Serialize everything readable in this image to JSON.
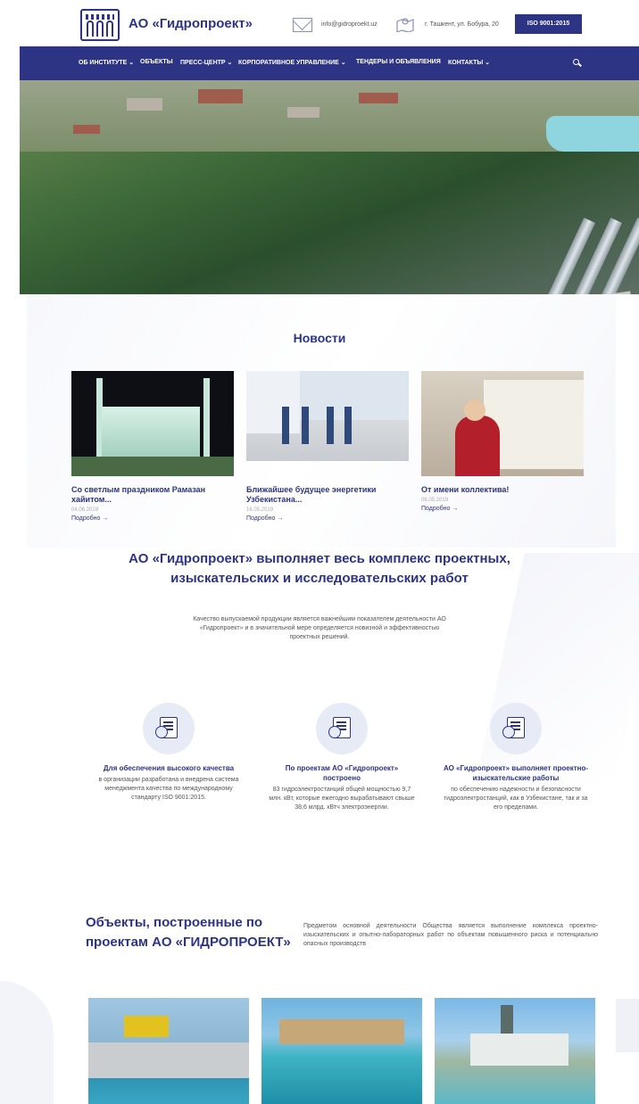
{
  "header": {
    "brand": "АО «Гидропроект»",
    "email": "info@gidroproekt.uz",
    "address": "г. Ташкент, ул. Бобура, 20",
    "iso_badge": "ISO 9001:2015"
  },
  "nav": {
    "items": [
      "ОБ ИНСТИТУТЕ ⌄",
      "ОБЪЕКТЫ",
      "ПРЕСС-ЦЕНТР ⌄",
      "КОРПОРАТИВНОЕ УПРАВЛЕНИЕ ⌄",
      "ТЕНДЕРЫ И ОБЪЯВЛЕНИЯ",
      "КОНТАКТЫ ⌄"
    ]
  },
  "news": {
    "title": "Новости",
    "items": [
      {
        "title": "Со светлым праздником Рамазан хайитом...",
        "date": "04.06.2019",
        "more": "Подробно →"
      },
      {
        "title": "Ближайшее будущее энергетики Узбекистана...",
        "date": "16.05.2019",
        "more": "Подробно →"
      },
      {
        "title": "От имени коллектива!",
        "date": "06.05.2019",
        "more": "Подробно →"
      }
    ]
  },
  "about": {
    "title": "АО «Гидропроект» выполняет весь комплекс проектных, изыскательских и исследовательских работ",
    "text": "Качество выпускаемой продукции является важнейшим показателем деятельности АО «Гидропроект» и в значительной мере определяется новизной и эффективностью проектных решений."
  },
  "features": [
    {
      "title": "Для обеспечения высокого качества",
      "text": "в организации разработана и внедрена система менеджмента качества по международному стандарту ISO 9001:2015."
    },
    {
      "title": "По проектам АО «Гидропроект» построено",
      "text": "83 гидроэлектростанций общей мощностью 9,7 млн. кВт, которые ежегодно вырабатывают свыше 38,6 млрд. кВтч электроэнергии."
    },
    {
      "title": "АО «Гидропроект» выполняет проектно-изыскательские работы",
      "text": "по обеспечению надежности и безопасности гидроэлектростанций, как в Узбекистане, так и за его пределами."
    }
  ],
  "objects": {
    "title": "Объекты, построенные по проектам АО «ГИДРОПРОЕКТ»",
    "text": "Предметом основной деятельности Общества является выполнение комплекса проектно-изыскательских и опытно-лабораторных работ по объектам повышенного риска и потенциально опасных производств"
  }
}
